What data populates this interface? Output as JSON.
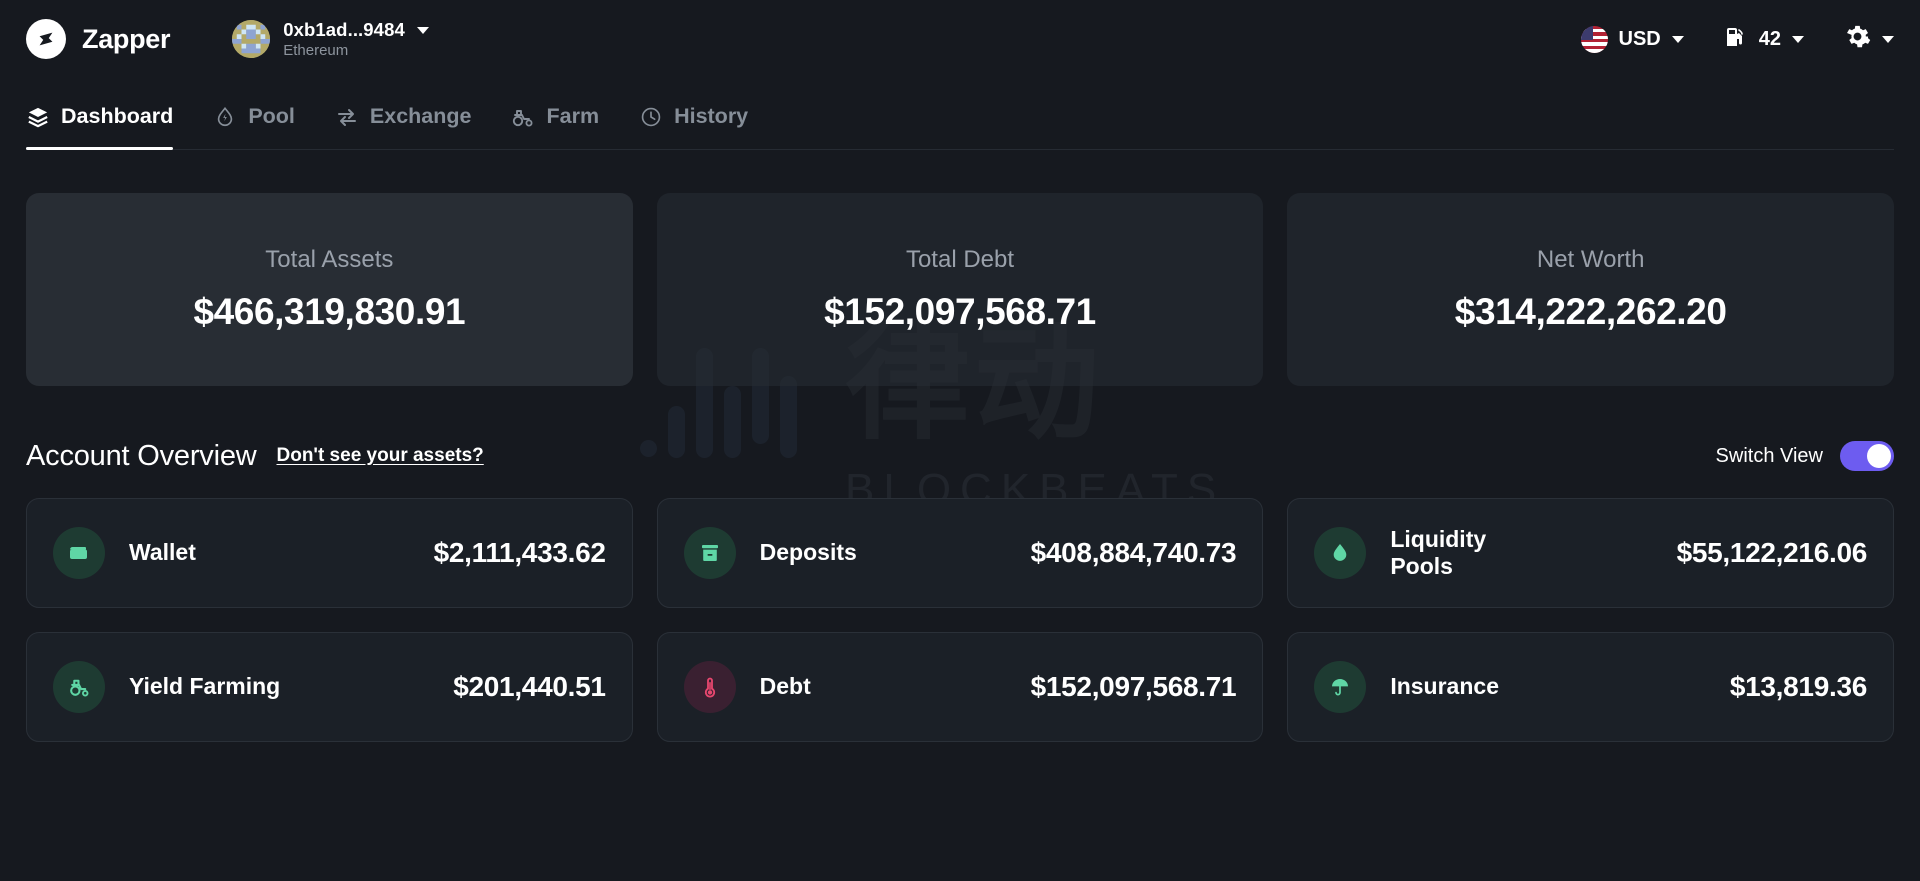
{
  "header": {
    "brand_name": "Zapper",
    "brand_icon": "zapper-logo-icon",
    "account": {
      "address": "0xb1ad...9484",
      "network": "Ethereum",
      "avatar_icon": "blockies-avatar-icon",
      "caret_icon": "chevron-down-icon"
    },
    "currency": {
      "label": "USD",
      "flag_icon": "us-flag-icon",
      "caret_icon": "chevron-down-icon"
    },
    "gas": {
      "label": "42",
      "icon": "gas-pump-icon",
      "caret_icon": "chevron-down-icon"
    },
    "settings": {
      "icon": "gear-icon",
      "caret_icon": "chevron-down-icon"
    }
  },
  "nav": {
    "items": [
      {
        "label": "Dashboard",
        "icon": "layers-icon",
        "active": true
      },
      {
        "label": "Pool",
        "icon": "droplet-bolt-icon",
        "active": false
      },
      {
        "label": "Exchange",
        "icon": "swap-arrows-icon",
        "active": false
      },
      {
        "label": "Farm",
        "icon": "tractor-icon",
        "active": false
      },
      {
        "label": "History",
        "icon": "clock-icon",
        "active": false
      }
    ]
  },
  "summary": {
    "cards": [
      {
        "label": "Total Assets",
        "value": "$466,319,830.91"
      },
      {
        "label": "Total Debt",
        "value": "$152,097,568.71"
      },
      {
        "label": "Net Worth",
        "value": "$314,222,262.20"
      }
    ]
  },
  "overview": {
    "title": "Account Overview",
    "help_link": "Don't see your assets?",
    "switch_label": "Switch View",
    "switch_on": true,
    "cards": [
      {
        "name": "Wallet",
        "value": "$2,111,433.62",
        "icon": "wallet-icon",
        "tone": "green"
      },
      {
        "name": "Deposits",
        "value": "$408,884,740.73",
        "icon": "deposit-box-icon",
        "tone": "green"
      },
      {
        "name": "Liquidity Pools",
        "value": "$55,122,216.06",
        "icon": "droplet-icon",
        "tone": "green"
      },
      {
        "name": "Yield Farming",
        "value": "$201,440.51",
        "icon": "tractor-icon",
        "tone": "green"
      },
      {
        "name": "Debt",
        "value": "$152,097,568.71",
        "icon": "thermometer-icon",
        "tone": "red"
      },
      {
        "name": "Insurance",
        "value": "$13,819.36",
        "icon": "umbrella-icon",
        "tone": "green"
      }
    ]
  },
  "watermark": {
    "text": "BLOCKBEATS",
    "cjk": "律动"
  },
  "colors": {
    "page_bg": "#16191f",
    "card_bg": "#282d34",
    "asset_card_bg": "#1b2027",
    "accent_green": "#5fd6a5",
    "accent_purple": "#6d5cf0",
    "accent_red": "#e8476f"
  }
}
